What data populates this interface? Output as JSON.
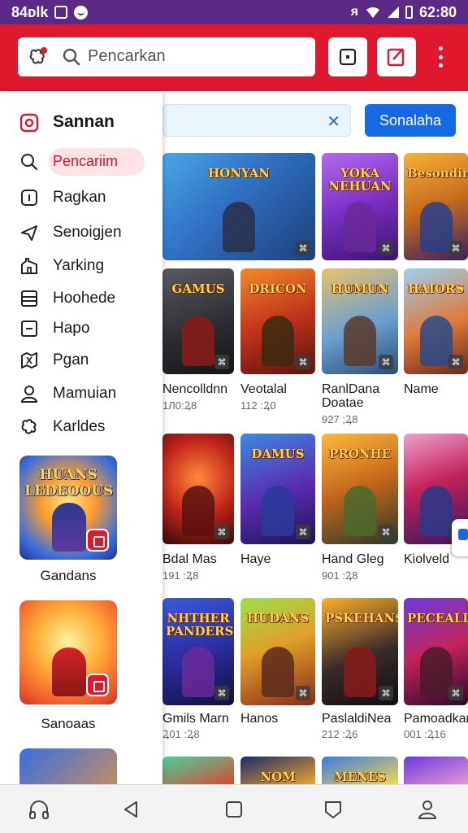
{
  "status_bar": {
    "left_text": "84ᴅlk",
    "time": "62:80"
  },
  "header": {
    "search_placeholder": "Pencarkan"
  },
  "filter": {
    "clear_symbol": "✕",
    "search_button_label": "Sonalaha"
  },
  "drawer": {
    "items": [
      {
        "label": "Sannan",
        "icon": "home-badge-icon"
      },
      {
        "label": "Pencariim",
        "icon": "search-icon"
      },
      {
        "label": "Ragkan",
        "icon": "info-square-icon"
      },
      {
        "label": "Senoigjen",
        "icon": "send-icon"
      },
      {
        "label": "Yarking",
        "icon": "building-icon"
      },
      {
        "label": "Hoohede",
        "icon": "list-icon"
      },
      {
        "label": "Hapo",
        "icon": "minus-square-icon"
      },
      {
        "label": "Pgan",
        "icon": "map-icon"
      },
      {
        "label": "Mamuian",
        "icon": "person-icon"
      },
      {
        "label": "Karldes",
        "icon": "puzzle-icon"
      }
    ],
    "promos": [
      {
        "thumb_title": "HUANS LEDEOOUS",
        "label": "Gandans"
      },
      {
        "thumb_title": "",
        "label": "Sanoaas"
      },
      {
        "thumb_title": "",
        "label": ""
      }
    ]
  },
  "grid": {
    "cards": [
      {
        "title": "HONYAN",
        "name": "",
        "meta": ""
      },
      {
        "title": "YOKA NEHUAN",
        "name": "",
        "meta": ""
      },
      {
        "title": "Besonding",
        "name": "",
        "meta": ""
      },
      {
        "title": "GAMUS",
        "name": "Nencolldnn",
        "meta": "1Л0:Ꝝ8"
      },
      {
        "title": "DRICON",
        "name": "Veotalal",
        "meta": "112 :Ꝝ0"
      },
      {
        "title": "HUMUN",
        "name": "RanlDana Doatae",
        "meta": "927 ;Ꝝ8"
      },
      {
        "title": "HAIORS",
        "name": "Name",
        "meta": ""
      },
      {
        "title": "",
        "name": "Bdal Mas",
        "meta": "191 :Ꝝ8"
      },
      {
        "title": "DAMUS",
        "name": "Haye",
        "meta": ""
      },
      {
        "title": "PRONHE",
        "name": "Hand Gleg",
        "meta": "901 :Ꝝ8"
      },
      {
        "title": "",
        "name": "Kiolveld",
        "meta": ""
      },
      {
        "title": "NHTHER PANDERS",
        "name": "Gmils Marn",
        "meta": "Ꝝ01 :Ꝝ8"
      },
      {
        "title": "HUDANS",
        "name": "Hanos",
        "meta": ""
      },
      {
        "title": "PSKEHANS",
        "name": "PaslaldiNea",
        "meta": "212 :Ꝝ6"
      },
      {
        "title": "PECEALIOUS",
        "name": "Pamoadkan",
        "meta": "001 :Ꝝ16"
      },
      {
        "title": "",
        "name": "",
        "meta": ""
      },
      {
        "title": "NOM",
        "name": "",
        "meta": ""
      },
      {
        "title": "MENES",
        "name": "",
        "meta": ""
      },
      {
        "title": "",
        "name": "",
        "meta": ""
      }
    ]
  },
  "colors": {
    "status_bar": "#5b2a86",
    "app_bar": "#e0182d",
    "accent_blue": "#1668e3",
    "active_pill": "#fde3e6"
  },
  "bottom_nav": [
    "headphones-icon",
    "back-icon",
    "home-square-icon",
    "shield-icon",
    "profile-icon"
  ]
}
